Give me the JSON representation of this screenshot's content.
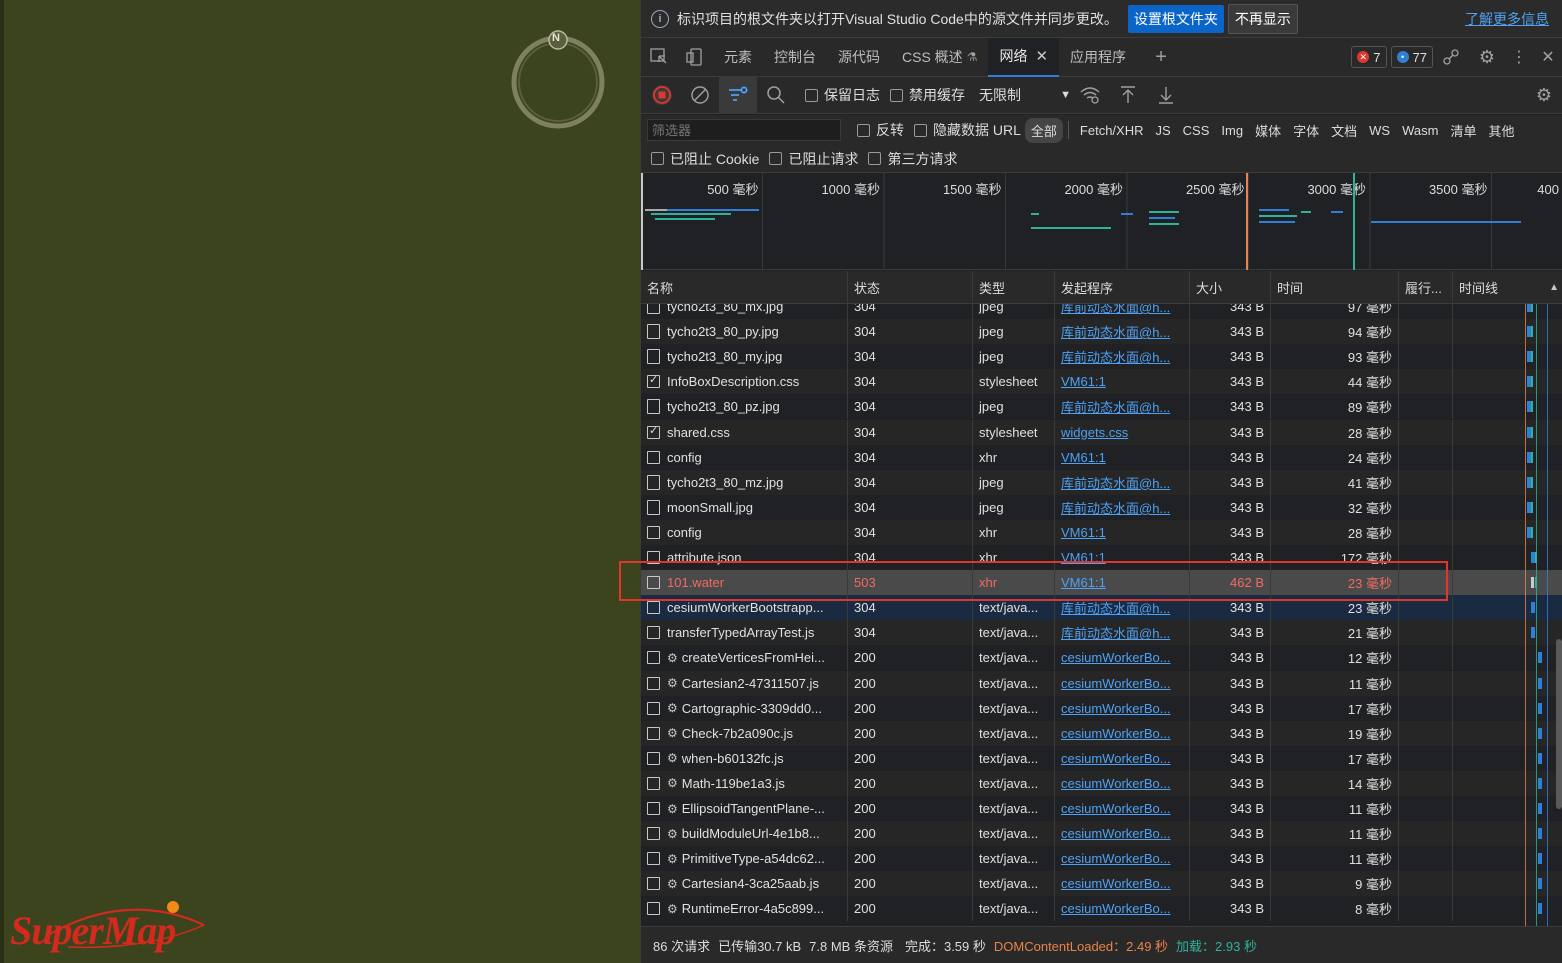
{
  "viewport": {
    "background": "#3c441d",
    "compass_letter": "N",
    "logo_text": "SuperMap"
  },
  "infobar": {
    "message": "标识项目的根文件夹以打开Visual Studio Code中的源文件并同步更改。",
    "primary_button": "设置根文件夹",
    "secondary_button": "不再显示",
    "learn_more": "了解更多信息"
  },
  "tabs": {
    "items": [
      "元素",
      "控制台",
      "源代码",
      "CSS 概述",
      "网络",
      "应用程序"
    ],
    "active": "网络",
    "errors_count": "7",
    "messages_count": "77"
  },
  "toolbar": {
    "preserve_log": "保留日志",
    "disable_cache": "禁用缓存",
    "throttle": "无限制"
  },
  "filter": {
    "placeholder": "筛选器",
    "invert": "反转",
    "hide_data_url": "隐藏数据 URL",
    "types": [
      "全部",
      "Fetch/XHR",
      "JS",
      "CSS",
      "Img",
      "媒体",
      "字体",
      "文档",
      "WS",
      "Wasm",
      "清单",
      "其他"
    ],
    "blocked_cookies": "已阻止 Cookie",
    "blocked_requests": "已阻止请求",
    "third_party": "第三方请求"
  },
  "overview": {
    "labels": [
      "500 毫秒",
      "1000 毫秒",
      "1500 毫秒",
      "2000 毫秒",
      "2500 毫秒",
      "3000 毫秒",
      "3500 毫秒",
      "400"
    ]
  },
  "table": {
    "headers": [
      "名称",
      "状态",
      "类型",
      "发起程序",
      "大小",
      "时间",
      "履行...",
      "时间线"
    ],
    "rows": [
      {
        "name": "tycho2t3_80_mx.jpg",
        "status": "304",
        "type": "jpeg",
        "initiator": "库前动态水面@h...",
        "size": "343 B",
        "time": "97 毫秒",
        "icon": "doc"
      },
      {
        "name": "tycho2t3_80_py.jpg",
        "status": "304",
        "type": "jpeg",
        "initiator": "库前动态水面@h...",
        "size": "343 B",
        "time": "94 毫秒",
        "icon": "doc"
      },
      {
        "name": "tycho2t3_80_my.jpg",
        "status": "304",
        "type": "jpeg",
        "initiator": "库前动态水面@h...",
        "size": "343 B",
        "time": "93 毫秒",
        "icon": "doc"
      },
      {
        "name": "InfoBoxDescription.css",
        "status": "304",
        "type": "stylesheet",
        "initiator": "VM61:1",
        "size": "343 B",
        "time": "44 毫秒",
        "icon": "css"
      },
      {
        "name": "tycho2t3_80_pz.jpg",
        "status": "304",
        "type": "jpeg",
        "initiator": "库前动态水面@h...",
        "size": "343 B",
        "time": "89 毫秒",
        "icon": "doc"
      },
      {
        "name": "shared.css",
        "status": "304",
        "type": "stylesheet",
        "initiator": "widgets.css",
        "size": "343 B",
        "time": "28 毫秒",
        "icon": "css"
      },
      {
        "name": "config",
        "status": "304",
        "type": "xhr",
        "initiator": "VM61:1",
        "size": "343 B",
        "time": "24 毫秒",
        "icon": "box"
      },
      {
        "name": "tycho2t3_80_mz.jpg",
        "status": "304",
        "type": "jpeg",
        "initiator": "库前动态水面@h...",
        "size": "343 B",
        "time": "41 毫秒",
        "icon": "doc"
      },
      {
        "name": "moonSmall.jpg",
        "status": "304",
        "type": "jpeg",
        "initiator": "库前动态水面@h...",
        "size": "343 B",
        "time": "32 毫秒",
        "icon": "doc"
      },
      {
        "name": "config",
        "status": "304",
        "type": "xhr",
        "initiator": "VM61:1",
        "size": "343 B",
        "time": "28 毫秒",
        "icon": "box"
      },
      {
        "name": "attribute.json",
        "status": "304",
        "type": "xhr",
        "initiator": "VM61:1",
        "size": "343 B",
        "time": "172 毫秒",
        "icon": "box"
      },
      {
        "name": "101.water",
        "status": "503",
        "type": "xhr",
        "initiator": "VM61:1",
        "size": "462 B",
        "time": "23 毫秒",
        "icon": "box",
        "error": true
      },
      {
        "name": "cesiumWorkerBootstrapp...",
        "status": "304",
        "type": "text/java...",
        "initiator": "库前动态水面@h...",
        "size": "343 B",
        "time": "23 毫秒",
        "icon": "box"
      },
      {
        "name": "transferTypedArrayTest.js",
        "status": "304",
        "type": "text/java...",
        "initiator": "库前动态水面@h...",
        "size": "343 B",
        "time": "21 毫秒",
        "icon": "box"
      },
      {
        "name": "createVerticesFromHei...",
        "status": "200",
        "type": "text/java...",
        "initiator": "cesiumWorkerBo...",
        "size": "343 B",
        "time": "12 毫秒",
        "icon": "box",
        "gear": true
      },
      {
        "name": "Cartesian2-47311507.js",
        "status": "200",
        "type": "text/java...",
        "initiator": "cesiumWorkerBo...",
        "size": "343 B",
        "time": "11 毫秒",
        "icon": "box",
        "gear": true
      },
      {
        "name": "Cartographic-3309dd0...",
        "status": "200",
        "type": "text/java...",
        "initiator": "cesiumWorkerBo...",
        "size": "343 B",
        "time": "17 毫秒",
        "icon": "box",
        "gear": true
      },
      {
        "name": "Check-7b2a090c.js",
        "status": "200",
        "type": "text/java...",
        "initiator": "cesiumWorkerBo...",
        "size": "343 B",
        "time": "19 毫秒",
        "icon": "box",
        "gear": true
      },
      {
        "name": "when-b60132fc.js",
        "status": "200",
        "type": "text/java...",
        "initiator": "cesiumWorkerBo...",
        "size": "343 B",
        "time": "17 毫秒",
        "icon": "box",
        "gear": true
      },
      {
        "name": "Math-119be1a3.js",
        "status": "200",
        "type": "text/java...",
        "initiator": "cesiumWorkerBo...",
        "size": "343 B",
        "time": "14 毫秒",
        "icon": "box",
        "gear": true
      },
      {
        "name": "EllipsoidTangentPlane-...",
        "status": "200",
        "type": "text/java...",
        "initiator": "cesiumWorkerBo...",
        "size": "343 B",
        "time": "11 毫秒",
        "icon": "box",
        "gear": true
      },
      {
        "name": "buildModuleUrl-4e1b8...",
        "status": "200",
        "type": "text/java...",
        "initiator": "cesiumWorkerBo...",
        "size": "343 B",
        "time": "11 毫秒",
        "icon": "box",
        "gear": true
      },
      {
        "name": "PrimitiveType-a54dc62...",
        "status": "200",
        "type": "text/java...",
        "initiator": "cesiumWorkerBo...",
        "size": "343 B",
        "time": "11 毫秒",
        "icon": "box",
        "gear": true
      },
      {
        "name": "Cartesian4-3ca25aab.js",
        "status": "200",
        "type": "text/java...",
        "initiator": "cesiumWorkerBo...",
        "size": "343 B",
        "time": "9 毫秒",
        "icon": "box",
        "gear": true
      },
      {
        "name": "RuntimeError-4a5c899...",
        "status": "200",
        "type": "text/java...",
        "initiator": "cesiumWorkerBo...",
        "size": "343 B",
        "time": "8 毫秒",
        "icon": "box",
        "gear": true
      }
    ]
  },
  "statusbar": {
    "requests": "86 次请求",
    "transferred": "已传输30.7 kB",
    "resources": "7.8 MB 条资源",
    "finish": "完成：3.59 秒",
    "dcl": "DOMContentLoaded：2.49 秒",
    "load": "加载：2.93 秒"
  },
  "colors": {
    "accent": "#0b65c8",
    "error": "#f06b65",
    "highlight_box": "#e0362e",
    "dcl": "#e8834c",
    "load": "#2eb39a"
  }
}
